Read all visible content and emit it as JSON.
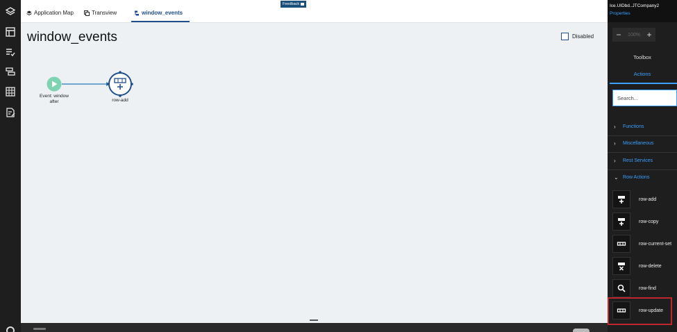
{
  "feedback": {
    "label": "Feedback"
  },
  "tabs": [
    {
      "label": "Application Map"
    },
    {
      "label": "Transview"
    },
    {
      "label": "window_events"
    }
  ],
  "canvas": {
    "title": "window_events",
    "disabled_label": "Disabled",
    "nodes": {
      "event_label_line1": "Event: window",
      "event_label_line2": "after",
      "action_label": "row-add"
    }
  },
  "panel": {
    "company": "Ice.UIDbd..JTCompany2",
    "properties_label": "Properties",
    "zoom_value": "100%",
    "zoom_minus": "−",
    "zoom_plus": "+",
    "toolbox_tab": "Toolbox",
    "actions_tab": "Actions",
    "search_placeholder": "Search...",
    "categories": [
      {
        "label": "Functions",
        "expanded": false
      },
      {
        "label": "Miscellaneous",
        "expanded": false
      },
      {
        "label": "Rest Services",
        "expanded": false
      },
      {
        "label": "Row Actions",
        "expanded": true
      }
    ],
    "actions": [
      {
        "label": "row-add",
        "icon": "row-add-icon"
      },
      {
        "label": "row-copy",
        "icon": "row-copy-icon"
      },
      {
        "label": "row-current-set",
        "icon": "row-current-set-icon"
      },
      {
        "label": "row-delete",
        "icon": "row-delete-icon"
      },
      {
        "label": "row-find",
        "icon": "search-icon"
      },
      {
        "label": "row-update",
        "icon": "row-update-icon"
      }
    ]
  },
  "colors": {
    "accent": "#3aa0ff",
    "tab_active": "#1f4f8a",
    "event_node": "#7ed3b2",
    "action_node": "#1f4f8a",
    "highlight": "#c0262d"
  }
}
